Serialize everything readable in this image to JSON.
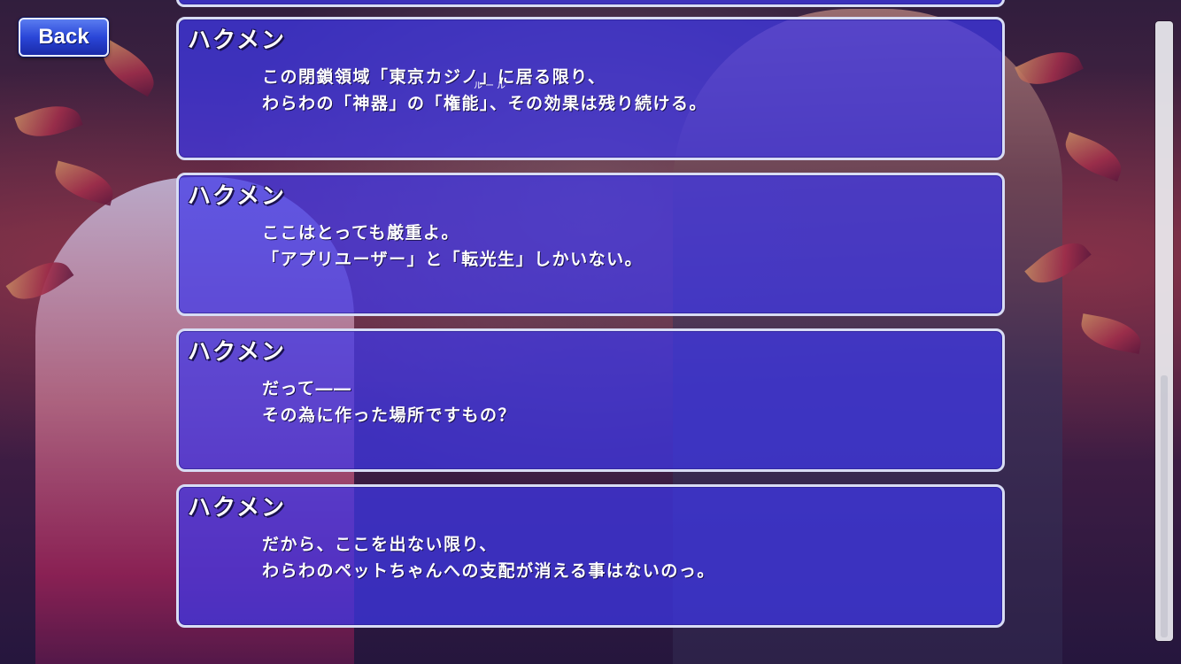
{
  "back_button": {
    "label": "Back"
  },
  "log": {
    "entries": [
      {
        "speaker": "ハクメン",
        "lines": [
          "この閉鎖領域「東京カジノ」に居る限り、",
          "わらわの「神器」の「権能」、その効果は残り続ける。"
        ],
        "ruby": "ルール"
      },
      {
        "speaker": "ハクメン",
        "lines": [
          "ここはとっても厳重よ。",
          "「アプリユーザー」と「転光生」しかいない。"
        ]
      },
      {
        "speaker": "ハクメン",
        "lines": [
          "だって――",
          "その為に作った場所ですもの？"
        ]
      },
      {
        "speaker": "ハクメン",
        "lines": [
          "だから、ここを出ない限り、",
          "わらわのペットちゃんへの支配が消える事はないのっ。"
        ]
      }
    ]
  },
  "scrollbar": {
    "position": 0.58
  },
  "colors": {
    "panel": "#3e38eb",
    "panel_border": "#d8dcf4",
    "button": "#2a46d8",
    "text": "#ffffff"
  }
}
